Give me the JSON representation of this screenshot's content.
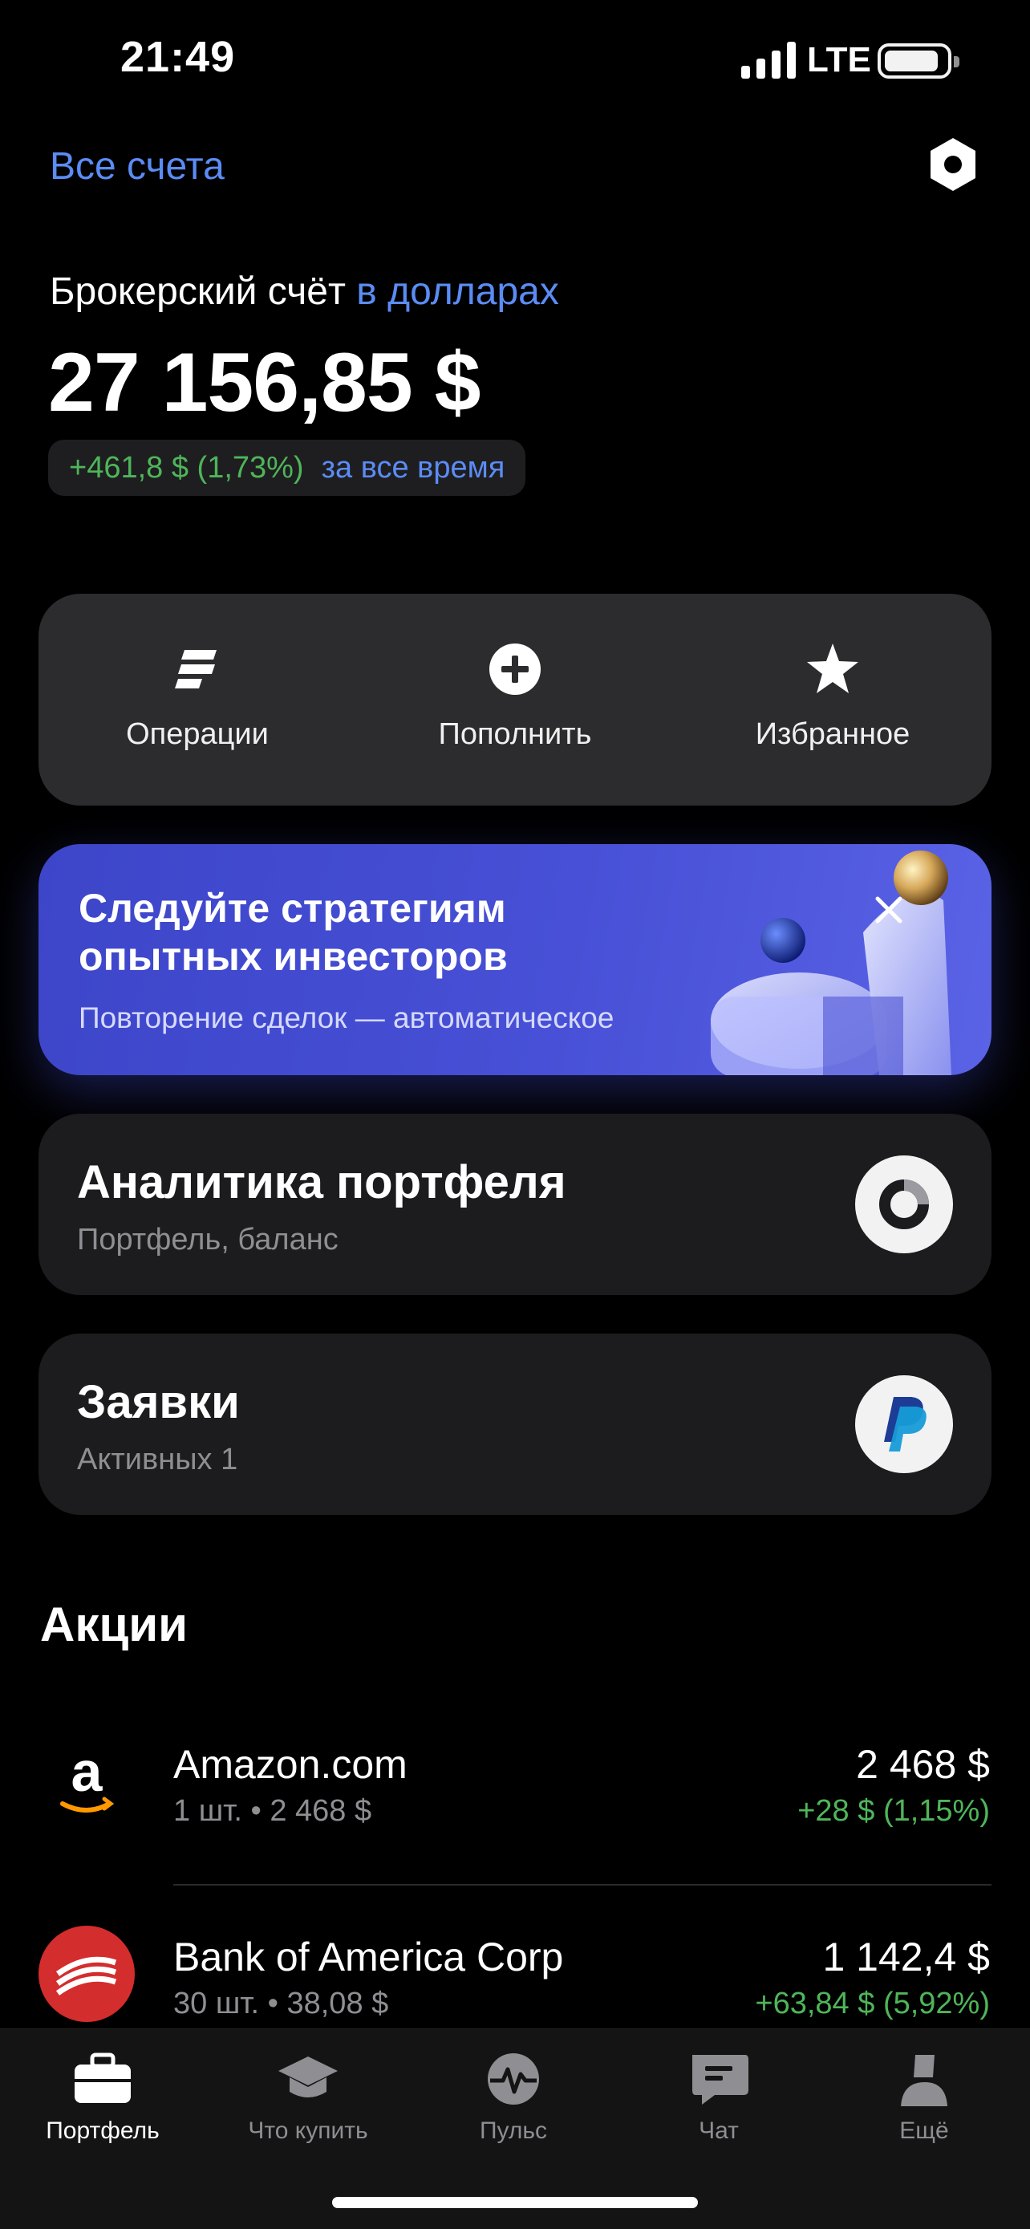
{
  "status_bar": {
    "time": "21:49",
    "network": "LTE"
  },
  "header": {
    "all_accounts": "Все счета",
    "settings_icon": "gear-icon"
  },
  "account": {
    "title_prefix": "Брокерский счёт",
    "title_currency": "в долларах",
    "balance": "27 156,85 $",
    "pnl": "+461,8 $ (1,73%)",
    "pnl_period": "за все время"
  },
  "actions": [
    {
      "label": "Операции",
      "icon": "operations-icon"
    },
    {
      "label": "Пополнить",
      "icon": "plus-circle-icon"
    },
    {
      "label": "Избранное",
      "icon": "star-icon"
    }
  ],
  "promo": {
    "title": "Следуйте стратегиям опытных инвесторов",
    "subtitle": "Повторение сделок — автоматическое"
  },
  "cards": {
    "analytics": {
      "title": "Аналитика портфеля",
      "subtitle": "Портфель, баланс"
    },
    "orders": {
      "title": "Заявки",
      "subtitle": "Активных 1"
    }
  },
  "stocks": {
    "section_title": "Акции",
    "items": [
      {
        "name": "Amazon.com",
        "meta": "1 шт. • 2 468 $",
        "price": "2 468 $",
        "change": "+28 $ (1,15%)"
      },
      {
        "name": "Bank of America Corp",
        "meta": "30 шт. • 38,08 $",
        "price": "1 142,4 $",
        "change": "+63,84 $ (5,92%)"
      }
    ]
  },
  "tabs": [
    {
      "label": "Портфель",
      "icon": "briefcase-icon",
      "active": true
    },
    {
      "label": "Что купить",
      "icon": "graduation-cap-icon",
      "active": false
    },
    {
      "label": "Пульс",
      "icon": "pulse-icon",
      "active": false
    },
    {
      "label": "Чат",
      "icon": "chat-icon",
      "active": false
    },
    {
      "label": "Ещё",
      "icon": "profile-icon",
      "active": false
    }
  ],
  "colors": {
    "accent": "#5b8cf5",
    "gain": "#4fb55a",
    "card": "#1c1c1e",
    "promo": "#4750d6"
  }
}
